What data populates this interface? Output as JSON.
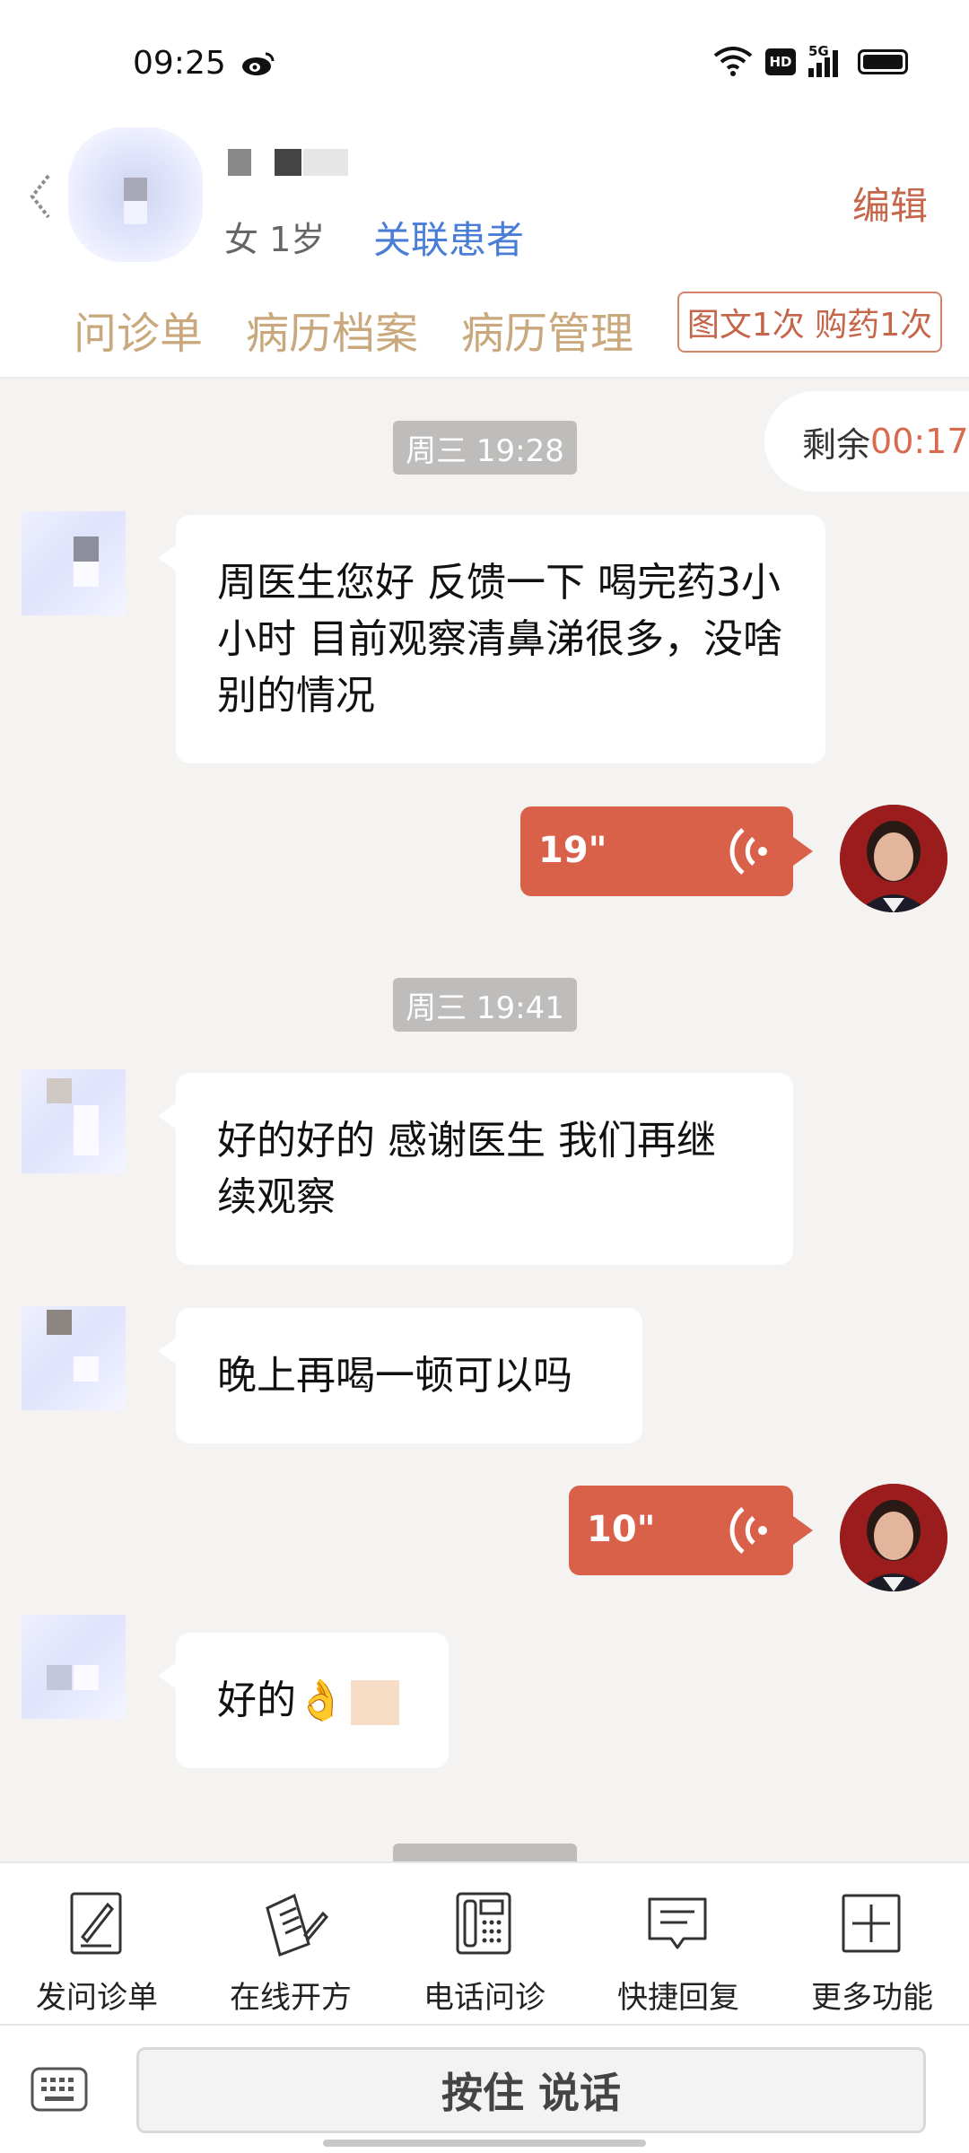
{
  "status_bar": {
    "time": "09:25",
    "app_icon": "weibo-icon",
    "network": "5G",
    "hd_label": "HD"
  },
  "header": {
    "gender_age": "女 1岁",
    "link_patient": "关联患者",
    "edit": "编辑",
    "tabs": [
      "问诊单",
      "病历档案",
      "病历管理"
    ],
    "quota": "图文1次 购药1次"
  },
  "chat": {
    "remaining_label": "剩余",
    "remaining_time": "00:17",
    "timestamps": [
      "周三 19:28",
      "周三 19:41"
    ],
    "messages": [
      {
        "from": "patient",
        "type": "text",
        "text": "周医生您好 反馈一下 喝完药3小小时 目前观察清鼻涕很多，没啥别的情况"
      },
      {
        "from": "doctor",
        "type": "voice",
        "duration": "19\""
      },
      {
        "from": "patient",
        "type": "text",
        "text": "好的好的 感谢医生 我们再继续观察"
      },
      {
        "from": "patient",
        "type": "text",
        "text": "晚上再喝一顿可以吗"
      },
      {
        "from": "doctor",
        "type": "voice",
        "duration": "10\""
      },
      {
        "from": "patient",
        "type": "text",
        "text": "好的👌"
      }
    ]
  },
  "toolbar": [
    {
      "label": "发问诊单",
      "icon": "form-edit-icon"
    },
    {
      "label": "在线开方",
      "icon": "prescription-icon"
    },
    {
      "label": "电话问诊",
      "icon": "phone-icon"
    },
    {
      "label": "快捷回复",
      "icon": "quick-reply-icon"
    },
    {
      "label": "更多功能",
      "icon": "plus-box-icon"
    }
  ],
  "input": {
    "hold_to_talk": "按住 说话",
    "keyboard_icon": "keyboard-icon"
  },
  "colors": {
    "accent": "#d9614a",
    "tab": "#c8a87c",
    "link": "#4a7ed6"
  }
}
